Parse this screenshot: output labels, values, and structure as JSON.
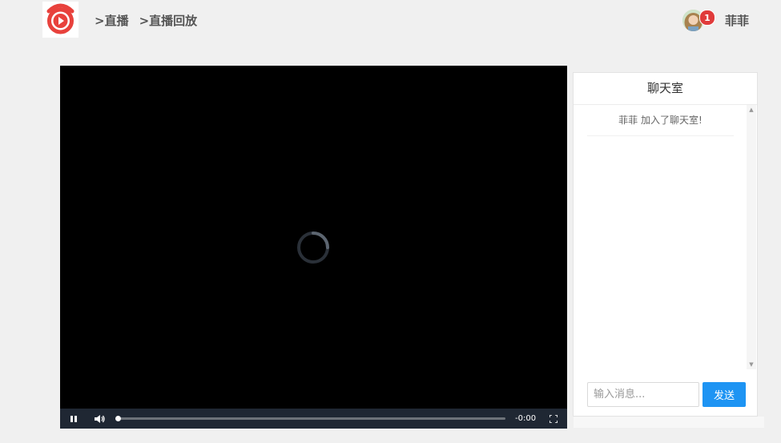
{
  "header": {
    "nav": [
      {
        "label": ">直播"
      },
      {
        "label": ">直播回放"
      }
    ],
    "user": {
      "name": "菲菲",
      "notification_count": "1"
    }
  },
  "player": {
    "state": "loading",
    "time_display": "-0:00",
    "progress": 0.0
  },
  "chat": {
    "title": "聊天室",
    "messages": [
      {
        "text": "菲菲 加入了聊天室!"
      }
    ],
    "input_placeholder": "输入消息...",
    "send_label": "发送"
  },
  "colors": {
    "brand": "#e8413c",
    "accent": "#1e94f3",
    "badge": "#e03b3b"
  },
  "icons": {
    "logo": "live-logo-icon",
    "play": "pause-icon",
    "volume": "volume-icon",
    "fullscreen": "fullscreen-icon"
  }
}
